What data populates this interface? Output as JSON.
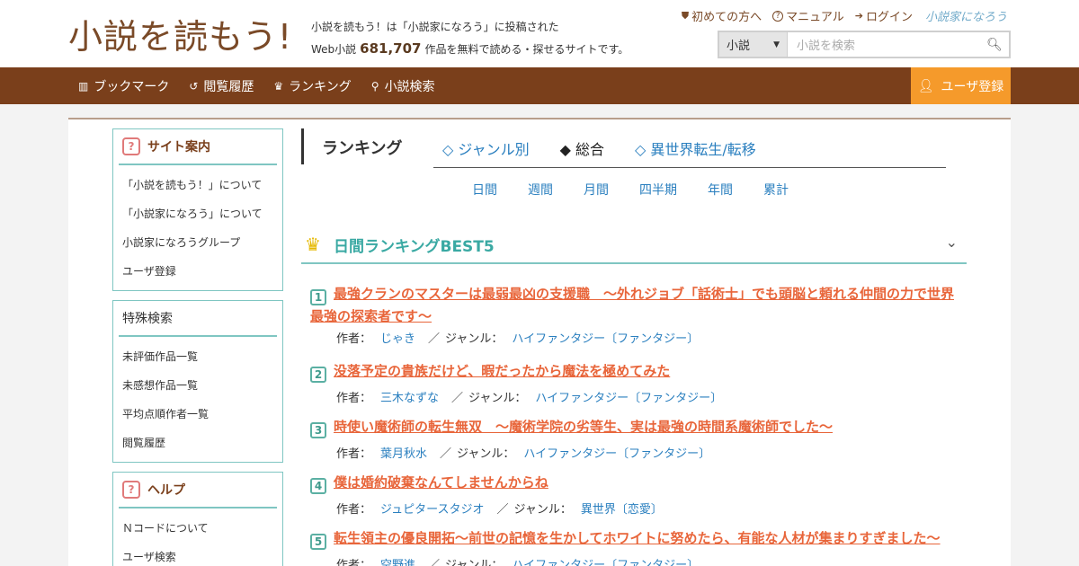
{
  "header": {
    "logo": "小説を読もう!",
    "tagline_line1": "小説を読もう！は「小説家になろう」に投稿された",
    "tagline_prefix": "Web小説",
    "count": "681,707",
    "tagline_suffix": "作品を無料で読める・探せるサイトです。",
    "links": [
      {
        "icon": "shield-icon",
        "glyph": "⛊",
        "label": "初めての方へ"
      },
      {
        "icon": "question-icon",
        "glyph": "?",
        "label": "マニュアル"
      },
      {
        "icon": "login-icon",
        "glyph": "➔",
        "label": "ログイン"
      }
    ],
    "narou_logo": "小説家になろう",
    "search": {
      "select": "小説",
      "placeholder": "小説を検索"
    }
  },
  "nav": {
    "items": [
      {
        "icon": "bookmark-icon",
        "glyph": "▥",
        "label": "ブックマーク"
      },
      {
        "icon": "history-icon",
        "glyph": "↺",
        "label": "閲覧履歴"
      },
      {
        "icon": "crown-icon",
        "glyph": "♛",
        "label": "ランキング"
      },
      {
        "icon": "search-icon",
        "glyph": "⚲",
        "label": "小説検索"
      }
    ],
    "register": "ユーザ登録"
  },
  "sidebar": {
    "site_guide": {
      "title": "サイト案内",
      "items": [
        "「小説を読もう！」について",
        "「小説家になろう」について",
        "小説家になろうグループ",
        "ユーザ登録"
      ]
    },
    "special_search": {
      "title": "特殊検索",
      "items": [
        "未評価作品一覧",
        "未感想作品一覧",
        "平均点順作者一覧",
        "閲覧履歴"
      ]
    },
    "help": {
      "title": "ヘルプ",
      "items": [
        "Ｎコードについて",
        "ユーザ検索"
      ]
    }
  },
  "ranking": {
    "title": "ランキング",
    "tabs": [
      "◇ ジャンル別",
      "◆ 総合",
      "◇ 異世界転生/転移"
    ],
    "periods": [
      "日間",
      "週間",
      "月間",
      "四半期",
      "年間",
      "累計"
    ],
    "best_title": "日間ランキングBEST5",
    "author_label": "作者：",
    "genre_label": "ジャンル：",
    "entries": [
      {
        "rank": "1",
        "title": "最強クランのマスターは最弱最凶の支援職　～外れジョブ「話術士」でも頭脳と頼れる仲間の力で世界最強の探索者です～",
        "author": "じゃき",
        "genre": "ハイファンタジー〔ファンタジー〕"
      },
      {
        "rank": "2",
        "title": "没落予定の貴族だけど、暇だったから魔法を極めてみた",
        "author": "三木なずな",
        "genre": "ハイファンタジー〔ファンタジー〕"
      },
      {
        "rank": "3",
        "title": "時使い魔術師の転生無双　～魔術学院の劣等生、実は最強の時間系魔術師でした～",
        "author": "葉月秋水",
        "genre": "ハイファンタジー〔ファンタジー〕"
      },
      {
        "rank": "4",
        "title": "僕は婚約破棄なんてしませんからね",
        "author": "ジュピタースタジオ",
        "genre": "異世界〔恋愛〕"
      },
      {
        "rank": "5",
        "title": "転生領主の優良開拓〜前世の記憶を生かしてホワイトに努めたら、有能な人材が集まりすぎました〜",
        "author": "空野進",
        "genre": "ハイファンタジー〔ファンタジー〕"
      }
    ]
  }
}
